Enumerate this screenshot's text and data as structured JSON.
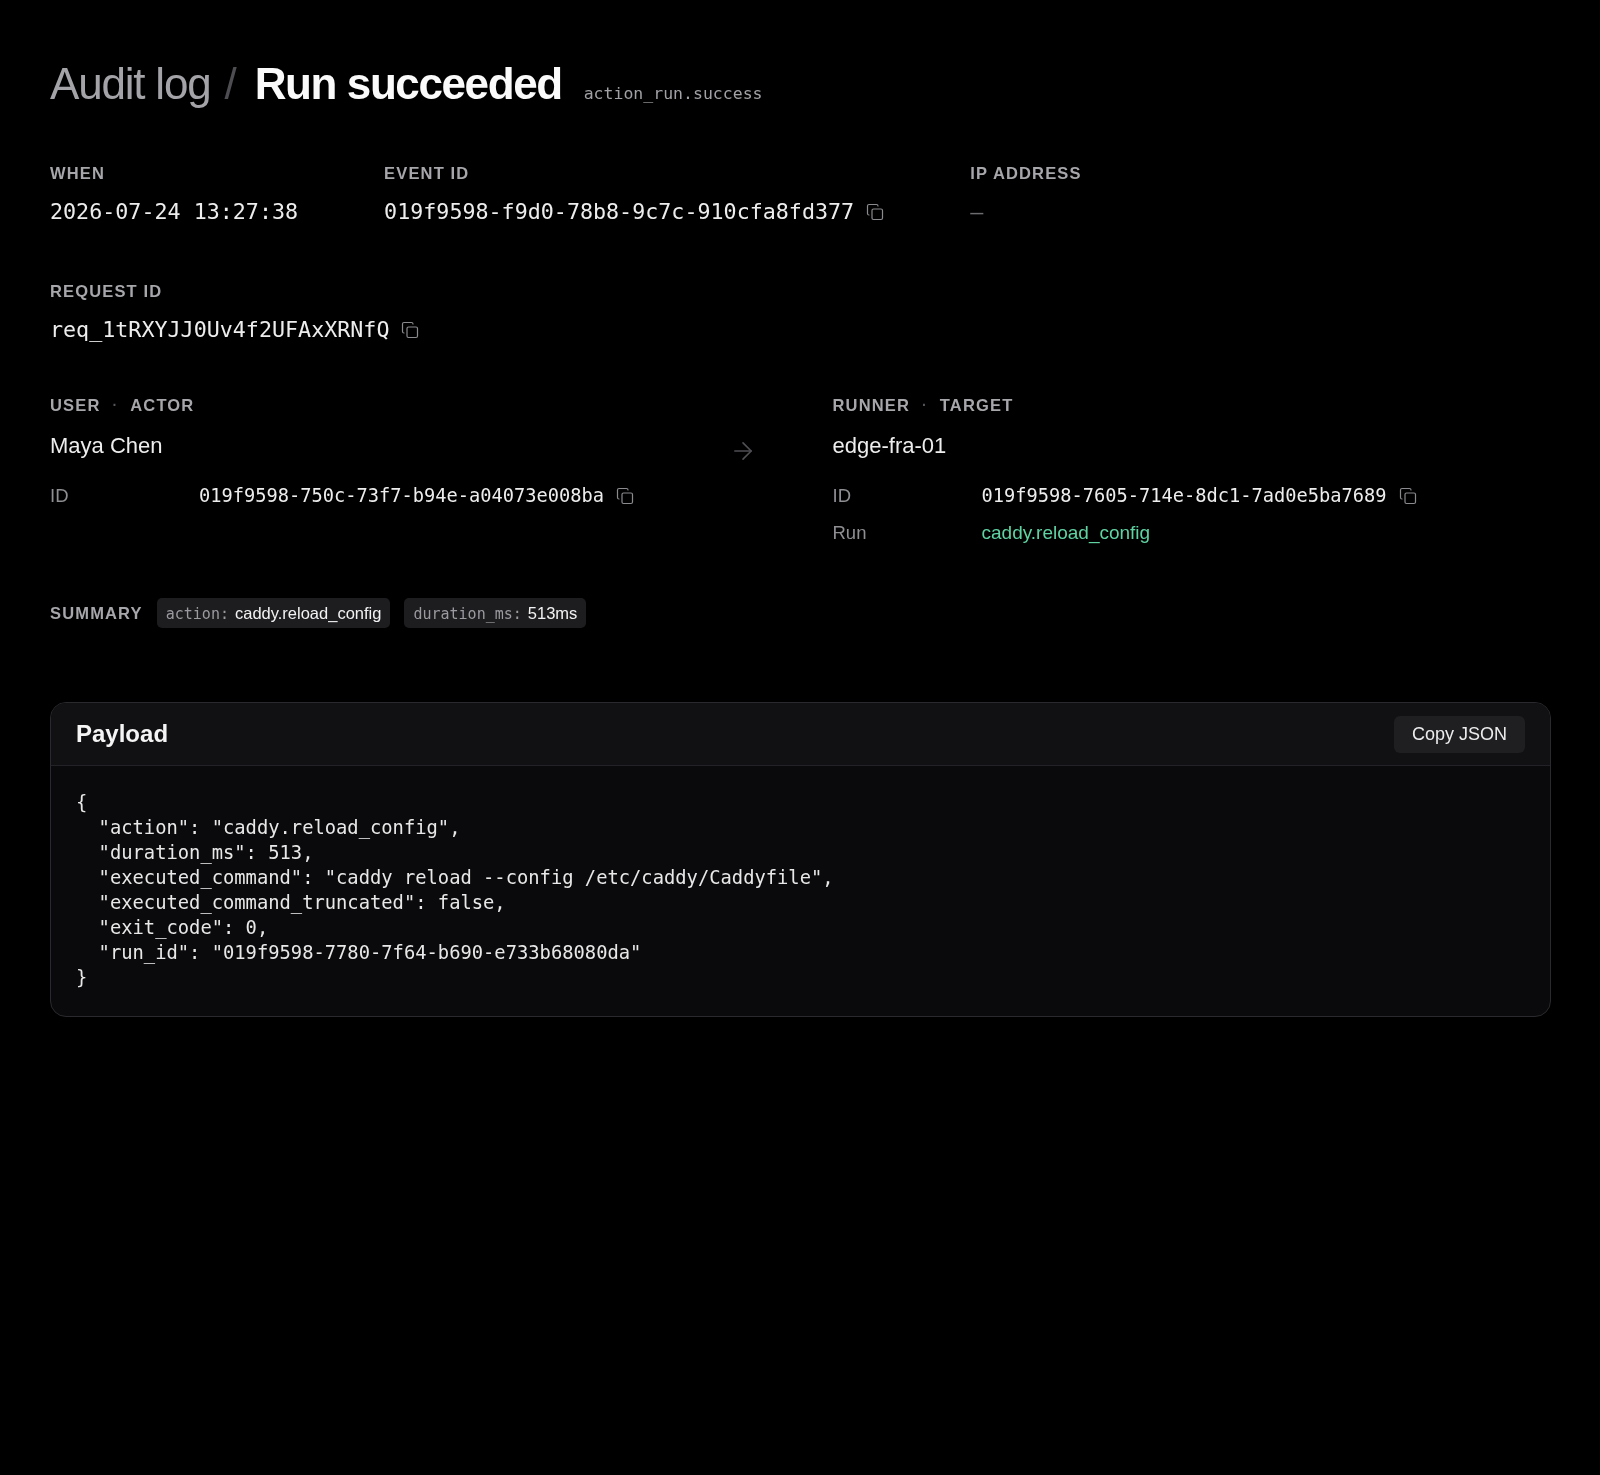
{
  "header": {
    "parent": "Audit log",
    "separator": "/",
    "title": "Run succeeded",
    "event_type": "action_run.success"
  },
  "fields": [
    {
      "label": "WHEN",
      "value": "2026-07-24 13:27:38",
      "copyable": false,
      "muted": false
    },
    {
      "label": "EVENT ID",
      "value": "019f9598-f9d0-78b8-9c7c-910cfa8fd377",
      "copyable": true,
      "muted": false
    },
    {
      "label": "IP ADDRESS",
      "value": "—",
      "copyable": false,
      "muted": true
    }
  ],
  "request": {
    "label": "REQUEST ID",
    "value": "req_1tRXYJJ0Uv4f2UFAxXRNfQ",
    "copyable": true
  },
  "parties": [
    {
      "role": "USER",
      "separator": "·",
      "relation": "ACTOR",
      "name": "Maya Chen",
      "details": [
        {
          "kind": "id",
          "label": "ID",
          "value": "019f9598-750c-73f7-b94e-a04073e008ba",
          "copyable": true
        }
      ]
    },
    {
      "role": "RUNNER",
      "separator": "·",
      "relation": "TARGET",
      "name": "edge-fra-01",
      "details": [
        {
          "kind": "id",
          "label": "ID",
          "value": "019f9598-7605-714e-8dc1-7ad0e5ba7689",
          "copyable": true
        },
        {
          "kind": "link",
          "label": "Run",
          "value": "caddy.reload_config",
          "copyable": false
        }
      ]
    }
  ],
  "summary": {
    "label": "SUMMARY",
    "chips": [
      {
        "key": "action:",
        "value": "caddy.reload_config"
      },
      {
        "key": "duration_ms:",
        "value": "513ms"
      }
    ]
  },
  "payload": {
    "title": "Payload",
    "copy_button": "Copy JSON",
    "lines": [
      "{",
      "  \"action\": \"caddy.reload_config\",",
      "  \"duration_ms\": 513,",
      "  \"executed_command\": \"caddy reload --config /etc/caddy/Caddyfile\",",
      "  \"executed_command_truncated\": false,",
      "  \"exit_code\": 0,",
      "  \"run_id\": \"019f9598-7780-7f64-b690-e733b68080da\"",
      "}"
    ]
  }
}
